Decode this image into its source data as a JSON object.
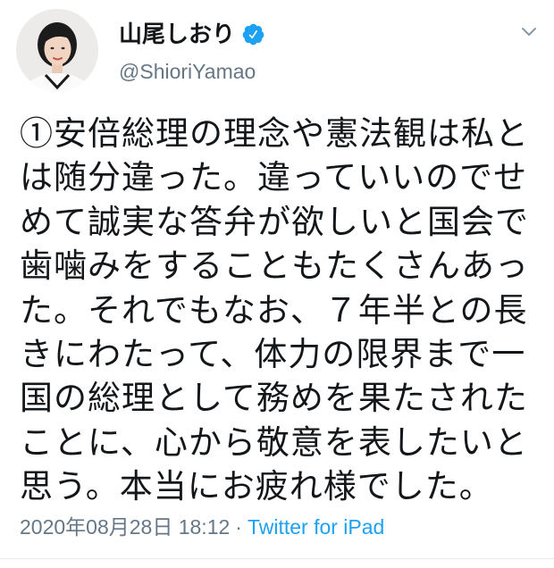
{
  "tweet": {
    "author": {
      "name": "山尾しおり",
      "handle": "@ShioriYamao",
      "verified": true,
      "avatar_icon": "profile-photo"
    },
    "text_lines": [
      "①安倍総理の理念や憲法観は私と",
      "は随分違った。違っていいのでせ",
      "めて誠実な答弁が欲しいと国会で",
      "歯噛みをすることもたくさんあっ",
      "た。それでもなお、７年半との長",
      "きにわたって、体力の限界まで一",
      "国の総理として務めを果たされた",
      "ことに、心から敬意を表したいと",
      "思う。本当にお疲れ様でした。"
    ],
    "timestamp": "2020年08月28日 18:12",
    "separator": "·",
    "source": "Twitter for iPad"
  },
  "icons": {
    "verified": "verified-badge-icon",
    "menu": "chevron-down-icon"
  },
  "colors": {
    "text": "#14171a",
    "secondary": "#657786",
    "accent": "#1da1f2",
    "divider": "#e6ecf0"
  }
}
